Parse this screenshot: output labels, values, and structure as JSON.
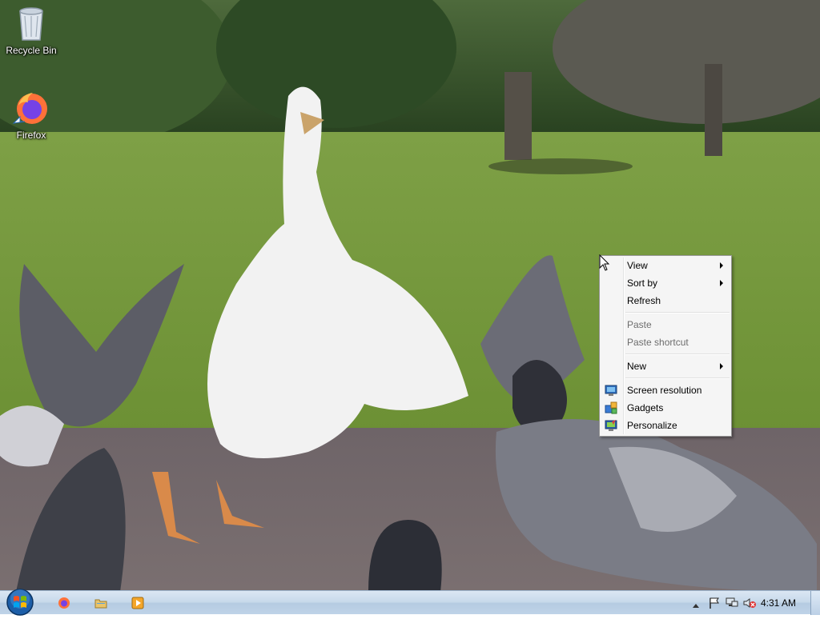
{
  "desktop": {
    "icons": [
      {
        "label": "Recycle Bin",
        "icon": "recycle-bin-icon"
      },
      {
        "label": "Firefox",
        "icon": "firefox-icon"
      }
    ]
  },
  "context_menu": {
    "items": [
      {
        "label": "View",
        "submenu": true,
        "enabled": true
      },
      {
        "label": "Sort by",
        "submenu": true,
        "enabled": true
      },
      {
        "label": "Refresh",
        "submenu": false,
        "enabled": true
      },
      {
        "label": "Paste",
        "submenu": false,
        "enabled": false
      },
      {
        "label": "Paste shortcut",
        "submenu": false,
        "enabled": false
      },
      {
        "label": "New",
        "submenu": true,
        "enabled": true
      },
      {
        "label": "Screen resolution",
        "icon": "screen-resolution-icon",
        "enabled": true
      },
      {
        "label": "Gadgets",
        "icon": "gadgets-icon",
        "enabled": true
      },
      {
        "label": "Personalize",
        "icon": "personalize-icon",
        "enabled": true
      }
    ]
  },
  "taskbar": {
    "start": "start-orb",
    "pinned": [
      "firefox-icon",
      "explorer-folder-icon",
      "media-player-icon"
    ],
    "tray_icons": [
      "show-hidden-icons-arrow",
      "action-center-flag-icon",
      "network-icon",
      "volume-muted-icon"
    ],
    "clock": "4:31 AM"
  },
  "colors": {
    "taskbar_top": "#dbe7f3",
    "menu_bg": "#f5f5f5",
    "menu_disabled_text": "#6d6d6d"
  }
}
